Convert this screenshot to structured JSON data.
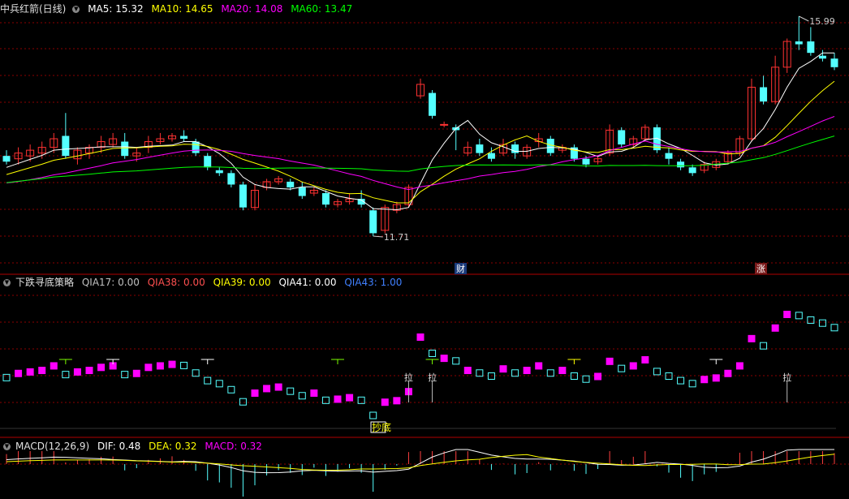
{
  "panel1": {
    "title": "中兵红箭(日线)",
    "ma": [
      {
        "label": "MA5: 15.32",
        "color": "#ffffff"
      },
      {
        "label": "MA10: 14.65",
        "color": "#ffff00"
      },
      {
        "label": "MA20: 14.08",
        "color": "#ff00ff"
      },
      {
        "label": "MA60: 13.47",
        "color": "#00ff00"
      }
    ],
    "high_label": "15.99",
    "low_label": "11.71",
    "badge_cai": "财",
    "badge_zhang": "涨"
  },
  "panel2": {
    "title": "下跌寻底策略",
    "values": [
      {
        "label": "QIA17: 0.00",
        "color": "#c0c0c0"
      },
      {
        "label": "QIA38: 0.00",
        "color": "#ff5050"
      },
      {
        "label": "QIA39: 0.00",
        "color": "#ffff00"
      },
      {
        "label": "QIA41: 0.00",
        "color": "#ffffff"
      },
      {
        "label": "QIA43: 1.00",
        "color": "#4080ff"
      }
    ],
    "pull_label": "拉",
    "bottom_label": "抄底"
  },
  "panel3": {
    "title": "MACD(12,26,9)",
    "values": [
      {
        "label": "DIF: 0.48",
        "color": "#ffffff"
      },
      {
        "label": "DEA: 0.32",
        "color": "#ffff00"
      },
      {
        "label": "MACD: 0.32",
        "color": "#ff00ff"
      }
    ]
  },
  "colors": {
    "up": "#ff3232",
    "down": "#54ffff",
    "ma5": "#ffffff",
    "ma10": "#ffff00",
    "ma20": "#ff00ff",
    "ma60": "#00ff00",
    "grid": "#8b0000"
  },
  "chart_data": {
    "type": "candlestick",
    "ylim": [
      11.71,
      15.99
    ],
    "candles": [
      [
        13.55,
        13.65,
        13.45,
        13.4
      ],
      [
        13.5,
        13.7,
        13.6,
        13.4
      ],
      [
        13.55,
        13.75,
        13.65,
        13.45
      ],
      [
        13.6,
        13.8,
        13.7,
        13.5
      ],
      [
        13.7,
        13.95,
        13.85,
        13.6
      ],
      [
        13.9,
        14.3,
        13.55,
        13.5
      ],
      [
        13.5,
        13.7,
        13.65,
        13.4
      ],
      [
        13.6,
        13.75,
        13.7,
        13.5
      ],
      [
        13.7,
        13.9,
        13.8,
        13.6
      ],
      [
        13.75,
        13.95,
        13.85,
        13.7
      ],
      [
        13.8,
        13.95,
        13.55,
        13.5
      ],
      [
        13.55,
        13.7,
        13.6,
        13.45
      ],
      [
        13.7,
        13.9,
        13.8,
        13.6
      ],
      [
        13.8,
        13.95,
        13.85,
        13.75
      ],
      [
        13.85,
        13.95,
        13.9,
        13.8
      ],
      [
        13.9,
        14.0,
        13.85,
        13.8
      ],
      [
        13.8,
        13.85,
        13.6,
        13.55
      ],
      [
        13.55,
        13.6,
        13.35,
        13.3
      ],
      [
        13.3,
        13.35,
        13.25,
        13.2
      ],
      [
        13.25,
        13.3,
        13.05,
        13.0
      ],
      [
        13.05,
        13.1,
        12.65,
        12.6
      ],
      [
        12.65,
        13.05,
        12.95,
        12.6
      ],
      [
        13.0,
        13.15,
        13.1,
        12.95
      ],
      [
        13.1,
        13.2,
        13.15,
        13.05
      ],
      [
        13.1,
        13.15,
        13.0,
        12.95
      ],
      [
        13.0,
        13.1,
        12.85,
        12.8
      ],
      [
        12.9,
        13.0,
        12.95,
        12.85
      ],
      [
        12.9,
        12.95,
        12.7,
        12.65
      ],
      [
        12.7,
        12.8,
        12.75,
        12.65
      ],
      [
        12.75,
        12.9,
        12.8,
        12.7
      ],
      [
        12.8,
        12.95,
        12.7,
        12.65
      ],
      [
        12.6,
        12.65,
        12.2,
        12.15
      ],
      [
        12.25,
        12.7,
        12.65,
        12.2
      ],
      [
        12.6,
        12.75,
        12.7,
        12.55
      ],
      [
        12.7,
        13.05,
        13.0,
        12.65
      ],
      [
        14.6,
        14.9,
        14.8,
        14.55
      ],
      [
        14.65,
        14.7,
        14.25,
        14.2
      ],
      [
        14.1,
        14.15,
        14.1,
        14.05
      ],
      [
        14.05,
        14.1,
        14.0,
        13.65
      ],
      [
        13.6,
        13.8,
        13.7,
        13.55
      ],
      [
        13.75,
        13.85,
        13.6,
        13.55
      ],
      [
        13.6,
        13.7,
        13.5,
        13.45
      ],
      [
        13.6,
        13.85,
        13.75,
        13.55
      ],
      [
        13.75,
        13.8,
        13.6,
        13.5
      ],
      [
        13.55,
        13.75,
        13.7,
        13.5
      ],
      [
        13.8,
        13.95,
        13.85,
        13.7
      ],
      [
        13.85,
        13.9,
        13.6,
        13.55
      ],
      [
        13.65,
        13.75,
        13.7,
        13.6
      ],
      [
        13.7,
        13.75,
        13.5,
        13.45
      ],
      [
        13.5,
        13.55,
        13.4,
        13.35
      ],
      [
        13.45,
        13.55,
        13.5,
        13.4
      ],
      [
        13.6,
        14.1,
        14.0,
        13.55
      ],
      [
        14.0,
        14.05,
        13.75,
        13.7
      ],
      [
        13.75,
        13.9,
        13.85,
        13.7
      ],
      [
        13.85,
        14.1,
        14.05,
        13.8
      ],
      [
        14.05,
        14.1,
        13.65,
        13.6
      ],
      [
        13.6,
        13.7,
        13.5,
        13.4
      ],
      [
        13.45,
        13.5,
        13.35,
        13.3
      ],
      [
        13.35,
        13.4,
        13.25,
        13.2
      ],
      [
        13.3,
        13.45,
        13.4,
        13.25
      ],
      [
        13.35,
        13.5,
        13.45,
        13.3
      ],
      [
        13.45,
        13.65,
        13.6,
        13.4
      ],
      [
        13.6,
        13.9,
        13.85,
        13.55
      ],
      [
        13.85,
        14.9,
        14.75,
        13.8
      ],
      [
        14.75,
        14.95,
        14.5,
        14.45
      ],
      [
        14.5,
        15.3,
        15.1,
        14.45
      ],
      [
        15.1,
        15.6,
        15.55,
        15.0
      ],
      [
        15.55,
        15.99,
        15.5,
        15.4
      ],
      [
        15.55,
        15.8,
        15.35,
        15.3
      ],
      [
        15.3,
        15.4,
        15.25,
        15.2
      ],
      [
        15.25,
        15.35,
        15.1,
        15.05
      ]
    ]
  }
}
